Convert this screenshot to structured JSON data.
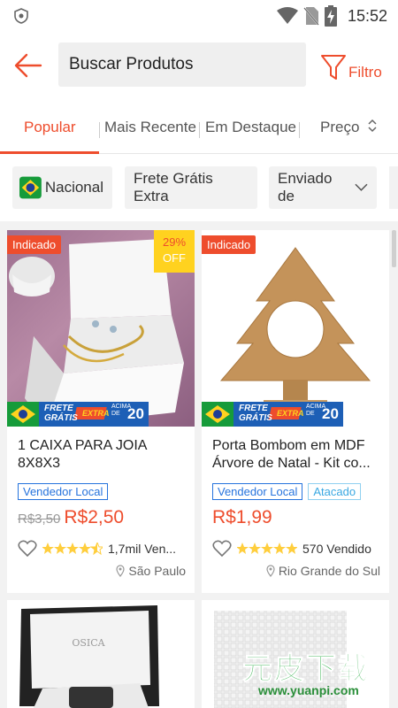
{
  "status": {
    "time": "15:52"
  },
  "header": {
    "search_placeholder": "Buscar Produtos",
    "filter_label": "Filtro"
  },
  "tabs": [
    {
      "label": "Popular",
      "active": true
    },
    {
      "label": "Mais Recente"
    },
    {
      "label": "Em Destaque"
    },
    {
      "label": "Preço"
    }
  ],
  "chips": [
    {
      "label": "Nacional"
    },
    {
      "label": "Frete Grátis Extra"
    },
    {
      "label": "Enviado de"
    }
  ],
  "products": [
    {
      "badge": "Indicado",
      "discount_pct": "29%",
      "discount_label": "OFF",
      "frete_text_1": "FRETE",
      "frete_text_2": "GRÁTIS",
      "frete_extra": "EXTRA",
      "frete_acima": "ACIMA DE",
      "frete_valor": "20",
      "title": "1 CAIXA PARA JOIA 8X8X3",
      "tags": [
        "Vendedor Local"
      ],
      "old_price": "R$3,50",
      "price": "R$2,50",
      "rating": 4.5,
      "sold": "1,7mil Ven...",
      "location": "São Paulo"
    },
    {
      "badge": "Indicado",
      "frete_text_1": "FRETE",
      "frete_text_2": "GRÁTIS",
      "frete_extra": "EXTRA",
      "frete_acima": "ACIMA DE",
      "frete_valor": "20",
      "title": "Porta Bombom em MDF Árvore de Natal - Kit co...",
      "tags": [
        "Vendedor Local",
        "Atacado"
      ],
      "price": "R$1,99",
      "rating": 5,
      "sold": "570 Vendido",
      "location": "Rio Grande do Sul"
    }
  ],
  "watermark": {
    "brand": "元皮下载",
    "url": "www.yuanpi.com"
  },
  "colors": {
    "accent": "#ee4d2d",
    "tag_blue": "#2673dd",
    "badge_yellow": "#ffd21f"
  }
}
